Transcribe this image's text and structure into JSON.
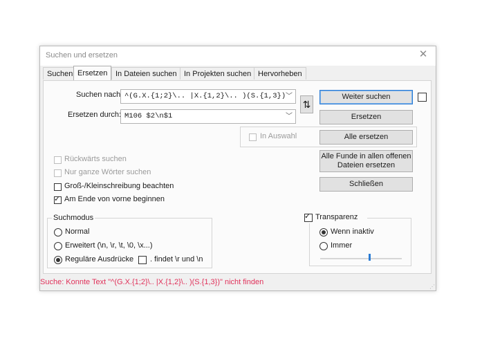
{
  "dialog": {
    "title": "Suchen und ersetzen",
    "close_glyph": "✕"
  },
  "tabs": [
    {
      "label": "Suchen"
    },
    {
      "label": "Ersetzen",
      "active": true
    },
    {
      "label": "In Dateien suchen"
    },
    {
      "label": "In Projekten suchen"
    },
    {
      "label": "Hervorheben"
    }
  ],
  "find": {
    "label": "Suchen nach:",
    "value": "^(G.X.{1;2}\\.. |X.{1,2}\\.. )(S.{1,3})"
  },
  "replace": {
    "label": "Ersetzen durch:",
    "value": "M106 $2\\n$1"
  },
  "swap_glyph": "⇅",
  "in_selection": {
    "label": "In Auswahl",
    "checked": false,
    "enabled": false
  },
  "options": {
    "backward": {
      "label": "Rückwärts suchen",
      "checked": false,
      "enabled": false
    },
    "whole_words": {
      "label": "Nur ganze Wörter suchen",
      "checked": false,
      "enabled": false
    },
    "match_case": {
      "label": "Groß-/Kleinschreibung beachten",
      "checked": false
    },
    "wrap_around": {
      "label": "Am Ende von vorne beginnen",
      "checked": true
    }
  },
  "search_mode": {
    "title": "Suchmodus",
    "normal": "Normal",
    "extended": "Erweitert (\\n, \\r, \\t, \\0, \\x...)",
    "regex": "Reguläre Ausdrücke",
    "selected": "regex",
    "dot_newline": ". findet \\r und \\n"
  },
  "transparency": {
    "label": "Transparenz",
    "checked": true,
    "on_lose_focus": "Wenn inaktiv",
    "always": "Immer",
    "selected": "on_lose_focus",
    "level": 0.6
  },
  "buttons": {
    "find_next": "Weiter suchen",
    "replace": "Ersetzen",
    "replace_all": "Alle ersetzen",
    "replace_all_open_line1": "Alle Funde in allen offenen",
    "replace_all_open_line2": "Dateien ersetzen",
    "close": "Schließen"
  },
  "status": {
    "text": "Suche: Konnte Text \"^(G.X.{1;2}\\.. |X.{1,2}\\.. )(S.{1,3})\" nicht finden",
    "color": "#e0315a"
  }
}
